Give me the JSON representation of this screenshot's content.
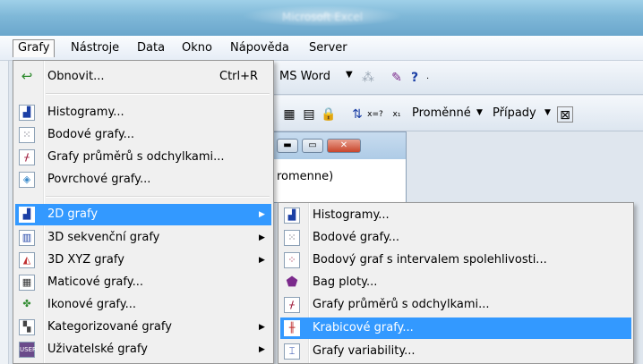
{
  "window": {
    "title": "Microsoft Excel"
  },
  "menubar": {
    "items": [
      {
        "label": "Grafy"
      },
      {
        "label": "Nástroje"
      },
      {
        "label": "Data"
      },
      {
        "label": "Okno"
      },
      {
        "label": "Nápověda"
      },
      {
        "label": "Server"
      }
    ]
  },
  "toolbar": {
    "ms_word_label": "MS Word",
    "variables_label": "Proměnné",
    "cases_label": "Případy"
  },
  "background": {
    "inner_field_text": "romenne)"
  },
  "menu_grafy": {
    "items": [
      {
        "label": "Obnovit...",
        "shortcut": "Ctrl+R",
        "icon": "refresh-arrow-icon"
      },
      {
        "label": "Histogramy...",
        "icon": "histogram-icon"
      },
      {
        "label": "Bodové grafy...",
        "icon": "scatter-plot-icon"
      },
      {
        "label": "Grafy průměrů s odchylkami...",
        "icon": "means-chart-icon"
      },
      {
        "label": "Povrchové grafy...",
        "icon": "surface-plot-icon"
      },
      {
        "label": "2D grafy",
        "icon": "2d-graphs-icon",
        "submenu": true
      },
      {
        "label": "3D sekvenční grafy",
        "icon": "3d-sequential-icon",
        "submenu": true
      },
      {
        "label": "3D XYZ grafy",
        "icon": "3d-xyz-icon",
        "submenu": true
      },
      {
        "label": "Maticové grafy...",
        "icon": "matrix-plot-icon"
      },
      {
        "label": "Ikonové grafy...",
        "icon": "icon-plot-icon"
      },
      {
        "label": "Kategorizované grafy",
        "icon": "categorized-graphs-icon",
        "submenu": true
      },
      {
        "label": "Uživatelské grafy",
        "icon": "user-graphs-icon",
        "submenu": true
      }
    ]
  },
  "menu_2d": {
    "items": [
      {
        "label": "Histogramy...",
        "icon": "histogram-icon"
      },
      {
        "label": "Bodové grafy...",
        "icon": "scatter-plot-icon"
      },
      {
        "label": "Bodový graf s intervalem spolehlivosti...",
        "icon": "scatter-ci-icon"
      },
      {
        "label": "Bag ploty...",
        "icon": "bag-plot-icon"
      },
      {
        "label": "Grafy průměrů s odchylkami...",
        "icon": "means-chart-icon"
      },
      {
        "label": "Krabicové grafy...",
        "icon": "box-plot-icon"
      },
      {
        "label": "Grafy variability...",
        "icon": "variability-plot-icon"
      }
    ]
  },
  "colors": {
    "highlight": "#3399ff",
    "menu_bg": "#f0f0f0",
    "menubar_bg": "#eef3f9"
  }
}
